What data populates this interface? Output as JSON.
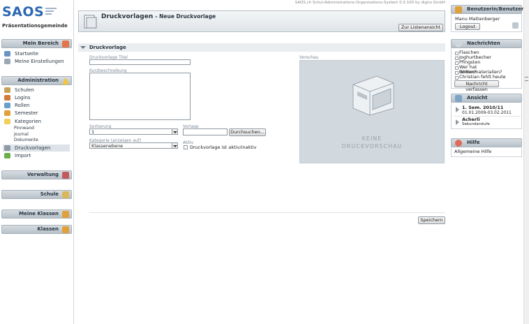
{
  "app": {
    "logo_text": "SAOS",
    "school_name": "Präsentationsgemeinde",
    "topbar_text": "SAOS.ch Schul-Administrations-Organisations-System 0.5.100 by digiro GmbH"
  },
  "sidebar": {
    "mein_bereich": {
      "title": "Mein Bereich",
      "items": [
        {
          "label": "Startseite",
          "icon": "home-icon"
        },
        {
          "label": "Meine Einstellungen",
          "icon": "wrench-icon"
        }
      ]
    },
    "administration": {
      "title": "Administration",
      "items": [
        {
          "label": "Schulen"
        },
        {
          "label": "Logins"
        },
        {
          "label": "Rollen"
        },
        {
          "label": "Semester"
        },
        {
          "label": "Kategorien"
        },
        {
          "label": "Druckvorlagen"
        },
        {
          "label": "Import"
        }
      ],
      "sub_items": [
        "Pinnwand",
        "Journal",
        "Dokumente"
      ]
    },
    "verwaltung": {
      "title": "Verwaltung"
    },
    "schule": {
      "title": "Schule"
    },
    "meine_klassen": {
      "title": "Meine Klassen"
    },
    "klassen": {
      "title": "Klassen"
    }
  },
  "header": {
    "title": "Druckvorlagen",
    "subtitle": "- Neue Druckvorlage",
    "list_button": "Zur Listenansicht"
  },
  "section": {
    "title": "Druckvorlage"
  },
  "form": {
    "title_label": "Druckvorlage Titel",
    "title_value": "",
    "description_label": "Kurzbeschreibung",
    "description_value": "",
    "sort_label": "Sortierung",
    "sort_value": "1",
    "template_label": "Vorlage",
    "browse_button": "Durchsuchen...",
    "category_label": "Kategorie (anzeigen auf)",
    "category_value": "Klassenebene",
    "active_label": "Aktiv",
    "active_checkbox_label": "Druckvorlage ist aktiv/inaktiv",
    "save_button": "Speichern"
  },
  "preview": {
    "label": "Vorschau",
    "empty_line1": "KEINE",
    "empty_line2": "DRUCKVORSCHAU"
  },
  "right": {
    "user": {
      "title": "Benutzerin/Benutzer",
      "name": "Manu Mattenberger",
      "logout": "Logout"
    },
    "messages": {
      "title": "Nachrichten",
      "items": [
        "Flaschen",
        "Joghurtbecher",
        "Pfingsten",
        "Wer hat Römermaterialien?",
        "Grillen?",
        "Christian fehlt heute"
      ],
      "compose": "Nachricht verfassen"
    },
    "view": {
      "title": "Ansicht",
      "semester": "1. Sem. 2010/11",
      "semester_dates": "01.01.2009-03.02.2011",
      "school": "Acherli",
      "school_level": "Sekundarstufe"
    },
    "help": {
      "title": "Hilfe",
      "link": "Allgemeine Hilfe"
    }
  },
  "colors": {
    "brand_blue": "#2b67b1",
    "panel_grey": "#b8c1c9",
    "preview_bg": "#d2d9de"
  }
}
